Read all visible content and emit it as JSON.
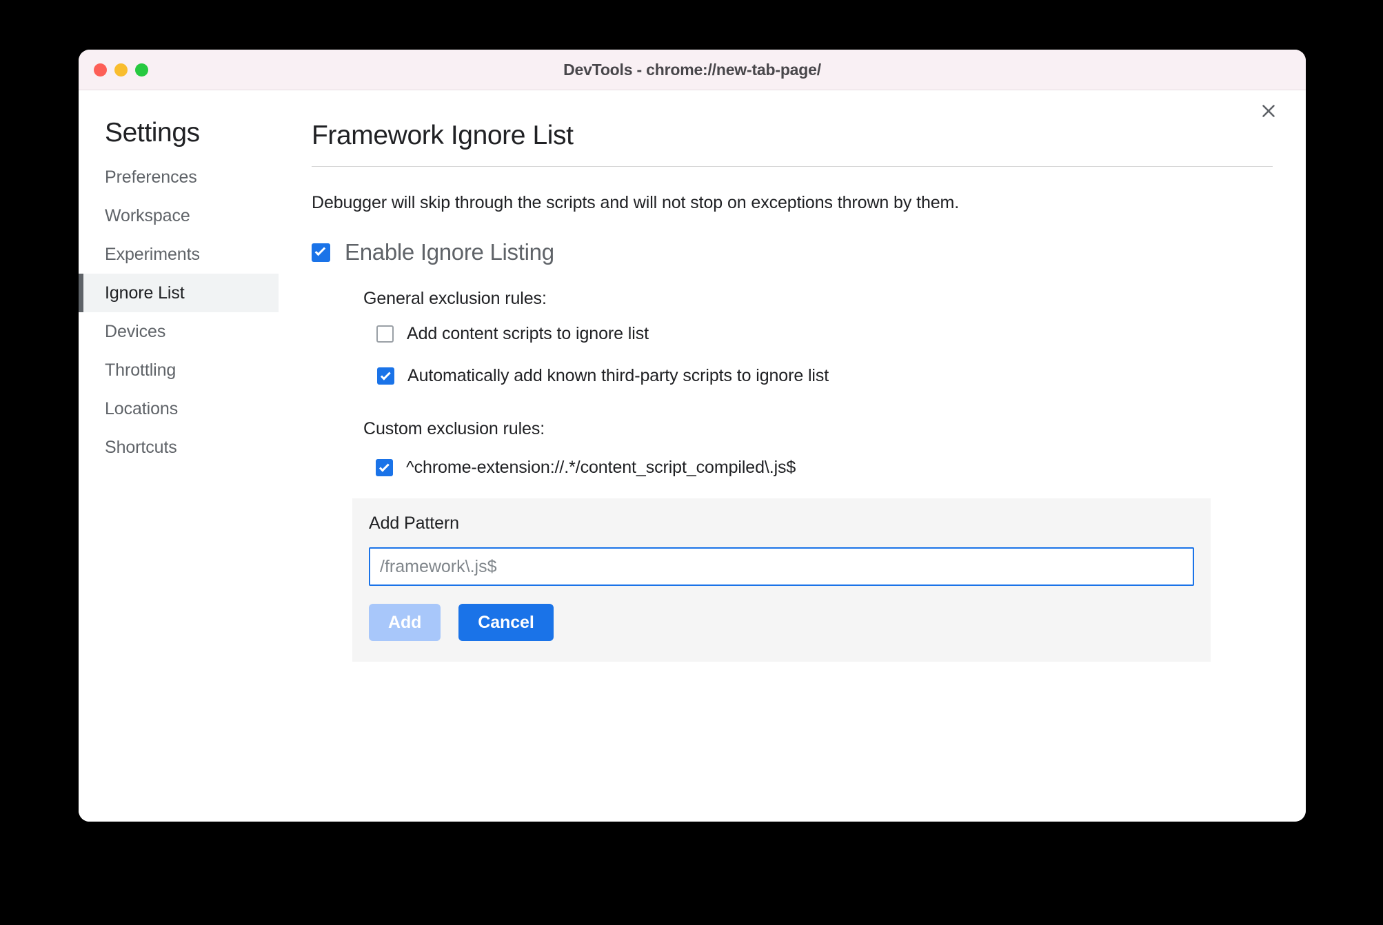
{
  "window": {
    "title": "DevTools - chrome://new-tab-page/",
    "traffic_lights": [
      "close",
      "minimize",
      "zoom"
    ],
    "colors": {
      "titlebar_bg": "#f9f0f4",
      "accent_blue": "#1a73e8",
      "disabled_blue": "#a8c7fa",
      "active_nav_bg": "#f1f3f4",
      "panel_bg": "#f5f5f5"
    }
  },
  "sidebar": {
    "heading": "Settings",
    "items": [
      {
        "label": "Preferences",
        "active": false
      },
      {
        "label": "Workspace",
        "active": false
      },
      {
        "label": "Experiments",
        "active": false
      },
      {
        "label": "Ignore List",
        "active": true
      },
      {
        "label": "Devices",
        "active": false
      },
      {
        "label": "Throttling",
        "active": false
      },
      {
        "label": "Locations",
        "active": false
      },
      {
        "label": "Shortcuts",
        "active": false
      }
    ]
  },
  "main": {
    "close_icon": "close-icon",
    "title": "Framework Ignore List",
    "description": "Debugger will skip through the scripts and will not stop on exceptions thrown by them.",
    "enable_toggle": {
      "label": "Enable Ignore Listing",
      "checked": true
    },
    "general_rules": {
      "label": "General exclusion rules:",
      "options": [
        {
          "label": "Add content scripts to ignore list",
          "checked": false
        },
        {
          "label": "Automatically add known third-party scripts to ignore list",
          "checked": true
        }
      ]
    },
    "custom_rules": {
      "label": "Custom exclusion rules:",
      "patterns": [
        {
          "label": "^chrome-extension://.*/content_script_compiled\\.js$",
          "checked": true
        }
      ]
    },
    "add_pattern": {
      "title": "Add Pattern",
      "input_value": "",
      "input_placeholder": "/framework\\.js$",
      "add_label": "Add",
      "add_disabled": true,
      "cancel_label": "Cancel"
    }
  }
}
